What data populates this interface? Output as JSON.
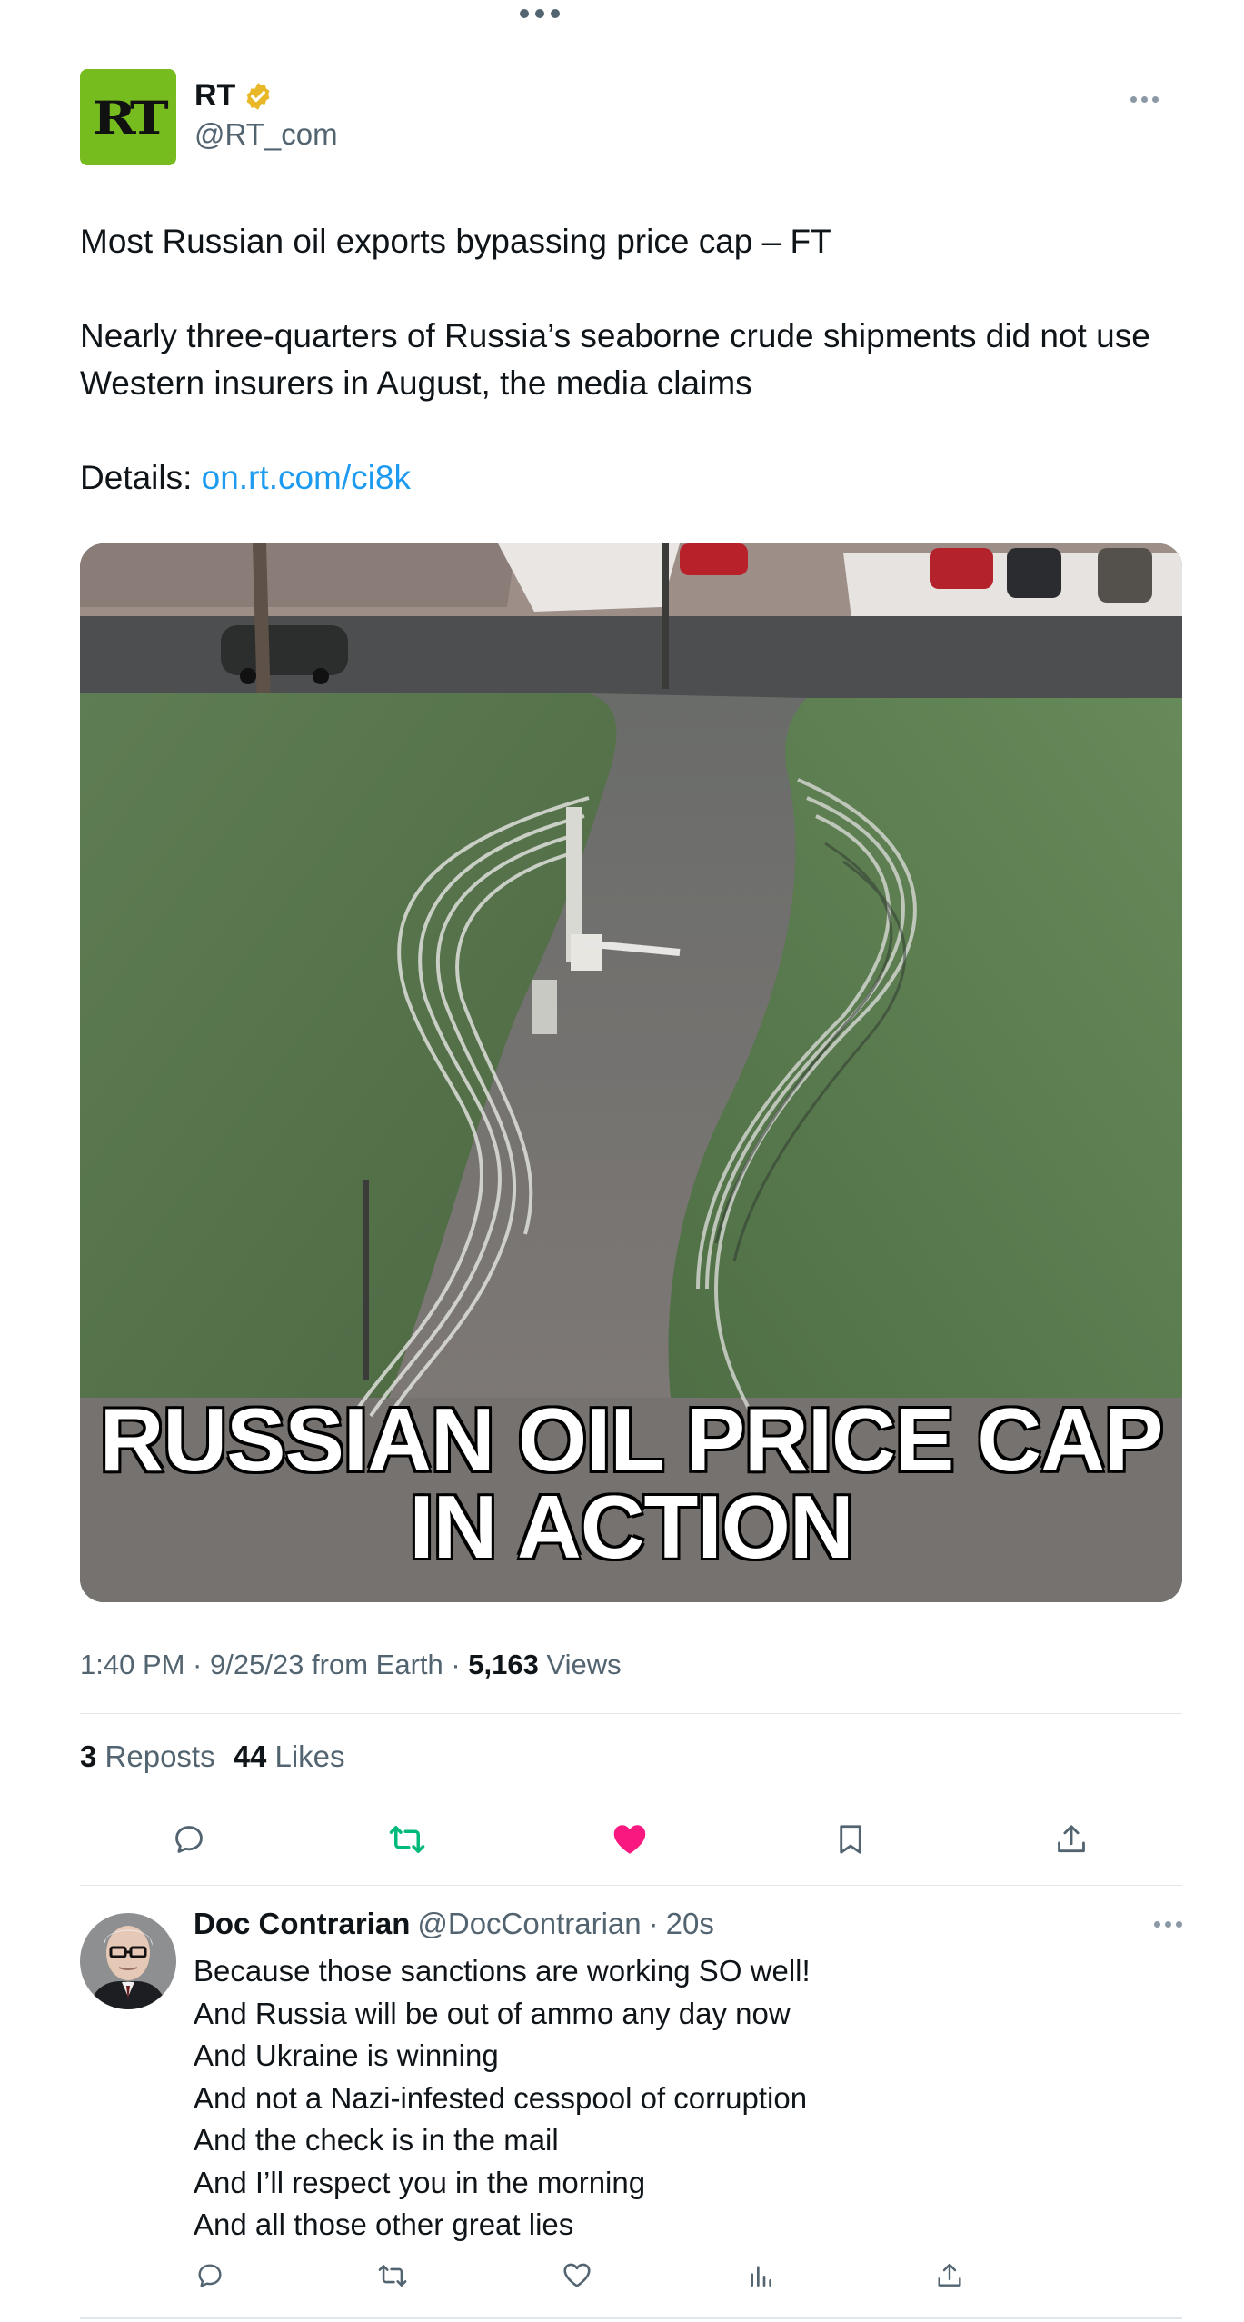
{
  "post": {
    "avatar_text": "RT",
    "author_name": "RT",
    "author_handle": "@RT_com",
    "headline": "Most Russian oil exports bypassing price cap – FT",
    "body": "Nearly three-quarters of Russia’s seaborne crude shipments did not use Western insurers in August, the media claims",
    "details_label": "Details: ",
    "details_link": "on.rt.com/ci8k",
    "image_caption_line1": "RUSSIAN OIL PRICE CAP",
    "image_caption_line2": "IN ACTION",
    "time": "1:40 PM · 9/25/23 from Earth · ",
    "views_count": "5,163",
    "views_label": " Views",
    "reposts_count": "3",
    "reposts_label": "Reposts",
    "likes_count": "44",
    "likes_label": "Likes"
  },
  "reply": {
    "author_name": "Doc Contrarian",
    "author_handle": "@DocContrarian",
    "separator": "·",
    "time": "20s",
    "lines": [
      "Because those sanctions are working SO well!",
      "And Russia will be out of ammo any day now",
      "And Ukraine is winning",
      "And not a Nazi-infested cesspool of corruption",
      "And the check is in the mail",
      "And I’ll respect you in the morning",
      "And all those other great lies"
    ]
  },
  "icons": {
    "reply": "reply-icon",
    "repost": "repost-icon",
    "like": "heart-icon",
    "bookmark": "bookmark-icon",
    "share": "share-icon",
    "views": "analytics-icon",
    "verified": "verified-badge-icon",
    "more": "more-icon"
  },
  "colors": {
    "brand_green": "#77bc1f",
    "link_blue": "#1d9bf0",
    "repost_green": "#00ba7c",
    "like_pink": "#f91880",
    "verified_gold": "#e8b829",
    "secondary_text": "#536471"
  },
  "state": {
    "reposted": true,
    "liked": true
  }
}
